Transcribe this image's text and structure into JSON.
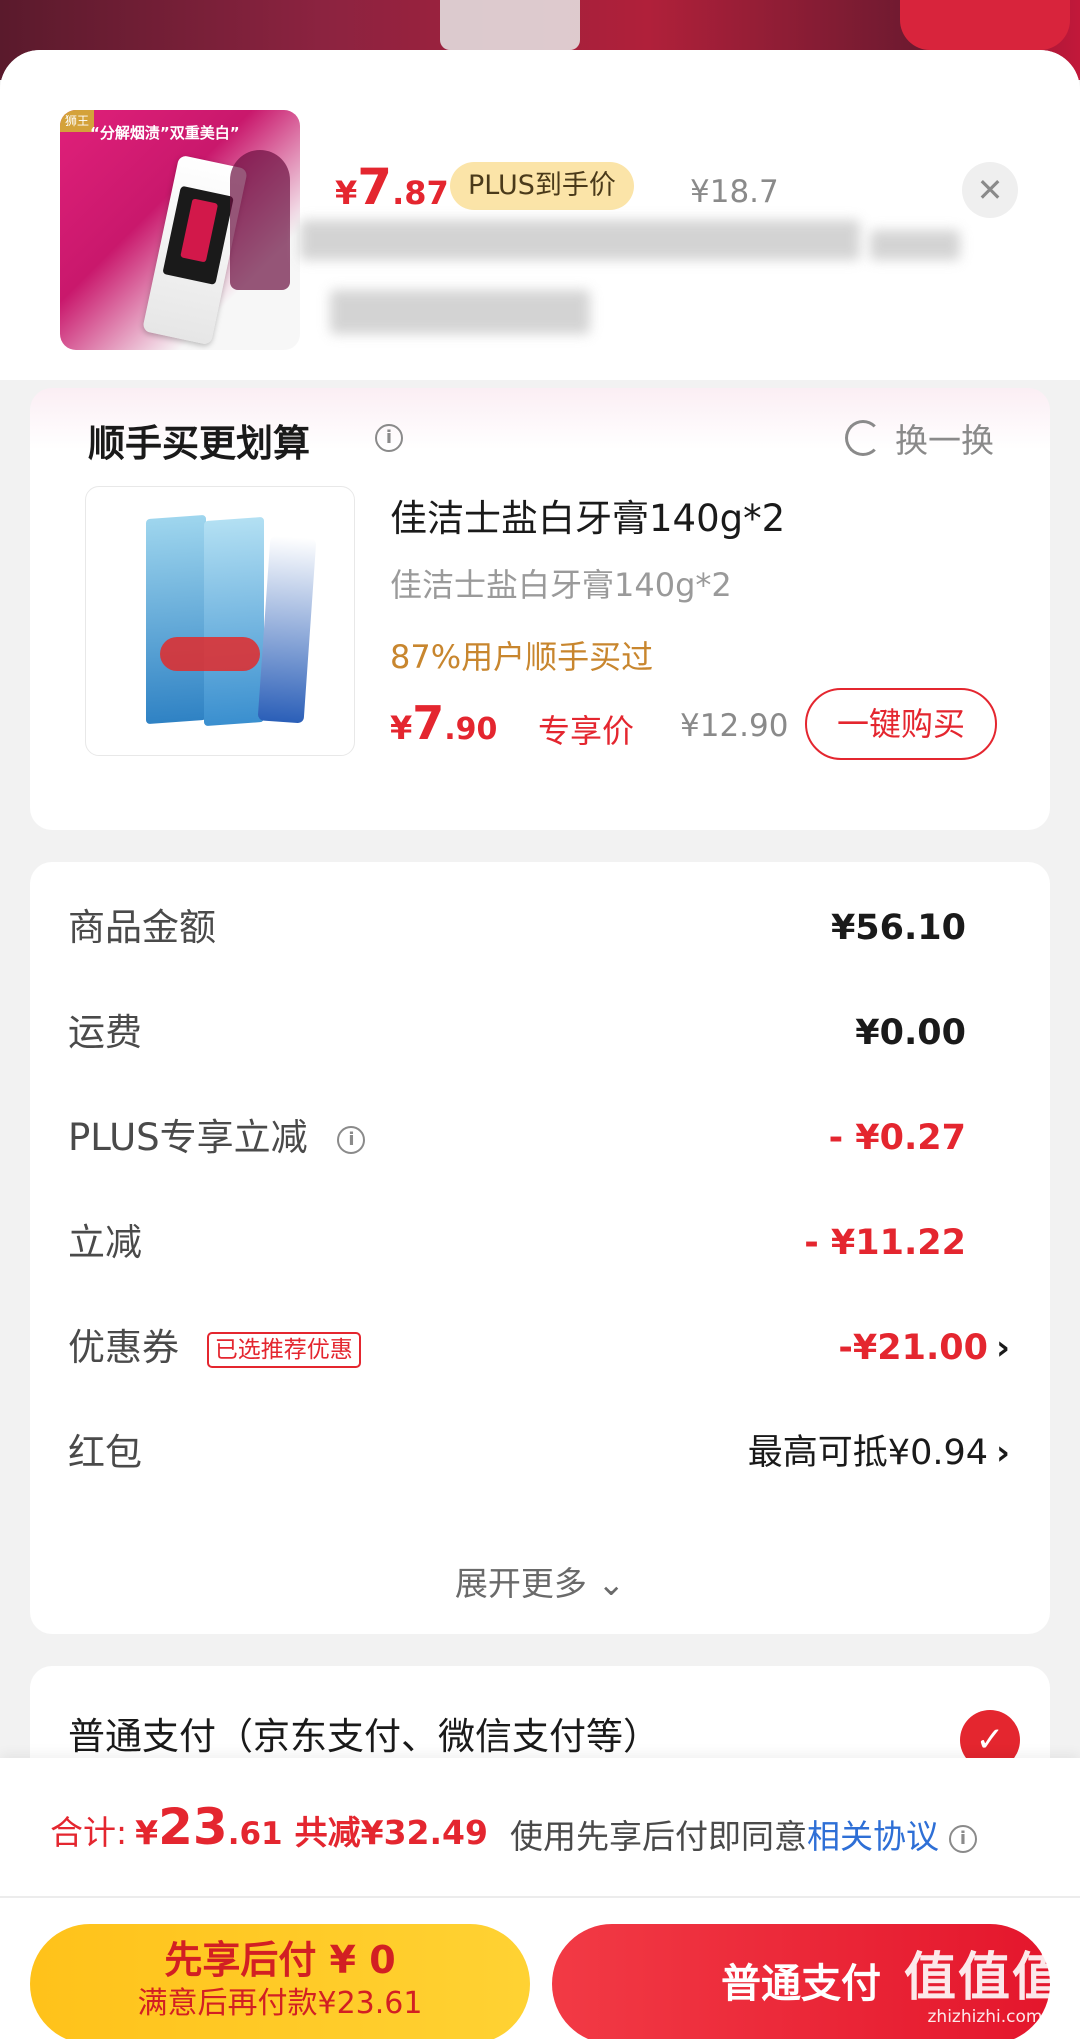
{
  "product": {
    "thumb_brand": "狮王",
    "thumb_slogan": "“分解烟渍”双重美白”",
    "price_symbol": "¥",
    "price_int": "7",
    "price_dec": ".87",
    "plus_badge": "PLUS到手价",
    "original_price": "¥18.7",
    "close_icon": "✕"
  },
  "addon": {
    "title": "顺手买更划算",
    "swap_label": "换一换",
    "name": "佳洁士盐白牙膏140g*2",
    "subtitle": "佳洁士盐白牙膏140g*2",
    "social_proof": "87%用户顺手买过",
    "price_symbol": "¥",
    "price_int": "7",
    "price_dec": ".90",
    "price_tag": "专享价",
    "original_price": "¥12.90",
    "buy_label": "一键购买"
  },
  "summary": {
    "rows": [
      {
        "label": "商品金额",
        "value": "¥56.10"
      },
      {
        "label": "运费",
        "value": "¥0.00"
      },
      {
        "label": "PLUS专享立减",
        "value": "- ¥0.27"
      },
      {
        "label": "立减",
        "value": "- ¥11.22"
      },
      {
        "label": "优惠券",
        "tag": "已选推荐优惠",
        "value": "-¥21.00"
      },
      {
        "label": "红包",
        "value": "最高可抵¥0.94"
      }
    ],
    "expand_label": "展开更多 ⌄"
  },
  "payment": {
    "option_label": "普通支付（京东支付、微信支付等）",
    "check_icon": "✓"
  },
  "bottom": {
    "total_label": "合计:",
    "total_symbol": "¥",
    "total_int": "23",
    "total_dec": ".61",
    "total_saved": "共减¥32.49",
    "agree_prefix": "使用先享后付即同意",
    "agree_link": "相关协议",
    "later_title": "先享后付 ¥ 0",
    "later_sub": "满意后再付款¥23.61",
    "pay_label": "普通支付",
    "watermark_big": "值值值",
    "watermark_small": "zhizhizhi.com"
  },
  "icons": {
    "info": "i",
    "chevron": "›"
  },
  "colors": {
    "accent_red": "#e4262f",
    "plus_gold": "#fbe4a8",
    "later_yellow": "#ffc21a",
    "link_blue": "#2e6fd6"
  }
}
